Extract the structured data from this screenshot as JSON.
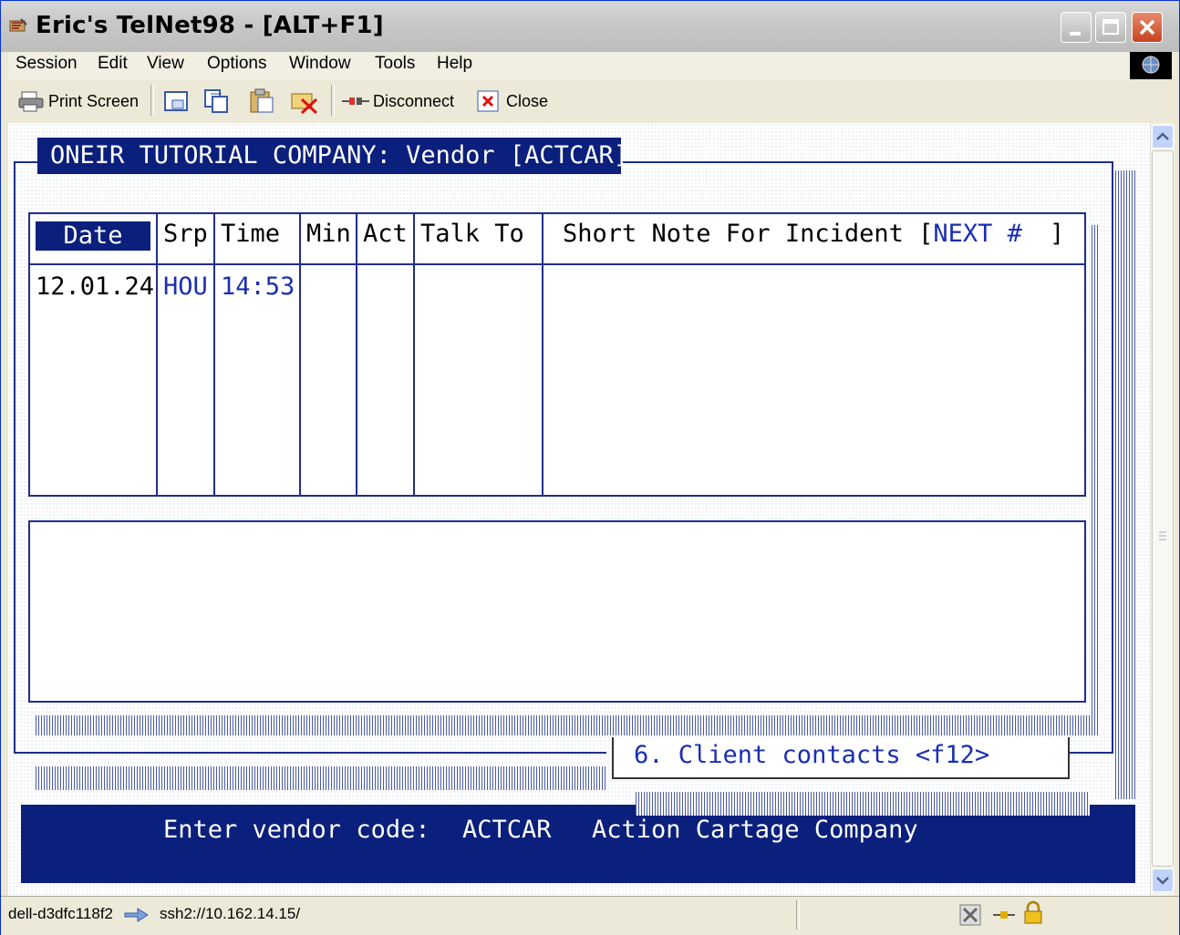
{
  "window": {
    "title": "Eric's TelNet98 - [ALT+F1]",
    "controls": [
      "minimize",
      "maximize",
      "close"
    ]
  },
  "menu": {
    "items": [
      "Session",
      "Edit",
      "View",
      "Options",
      "Window",
      "Tools",
      "Help"
    ]
  },
  "toolbar": {
    "print_label": "Print Screen",
    "disconnect_label": "Disconnect",
    "close_label": "Close"
  },
  "terminal": {
    "screen_title": "ONEIR TUTORIAL COMPANY: Vendor [ACTCAR]",
    "table": {
      "headers": [
        "Date",
        "Srp",
        "Time",
        "Min",
        "Act",
        "Talk To"
      ],
      "note_header": "Short Note For Incident [",
      "note_header_next": "NEXT #",
      "note_header_end": "]",
      "row": {
        "date": "12.01.24",
        "srp": "HOU",
        "time": "14:53"
      }
    },
    "menu_option": "6. Client contacts <f12>",
    "prompt": {
      "label": "Enter vendor code:",
      "code": "ACTCAR",
      "name": "Action Cartage Company"
    }
  },
  "statusbar": {
    "host": "dell-d3dfc118f2",
    "connection": "ssh2://10.162.14.15/"
  },
  "colors": {
    "terminal_blue": "#1f2e8c",
    "highlight_navy": "#0b1f7c",
    "field_blue": "#1a2fb0"
  }
}
